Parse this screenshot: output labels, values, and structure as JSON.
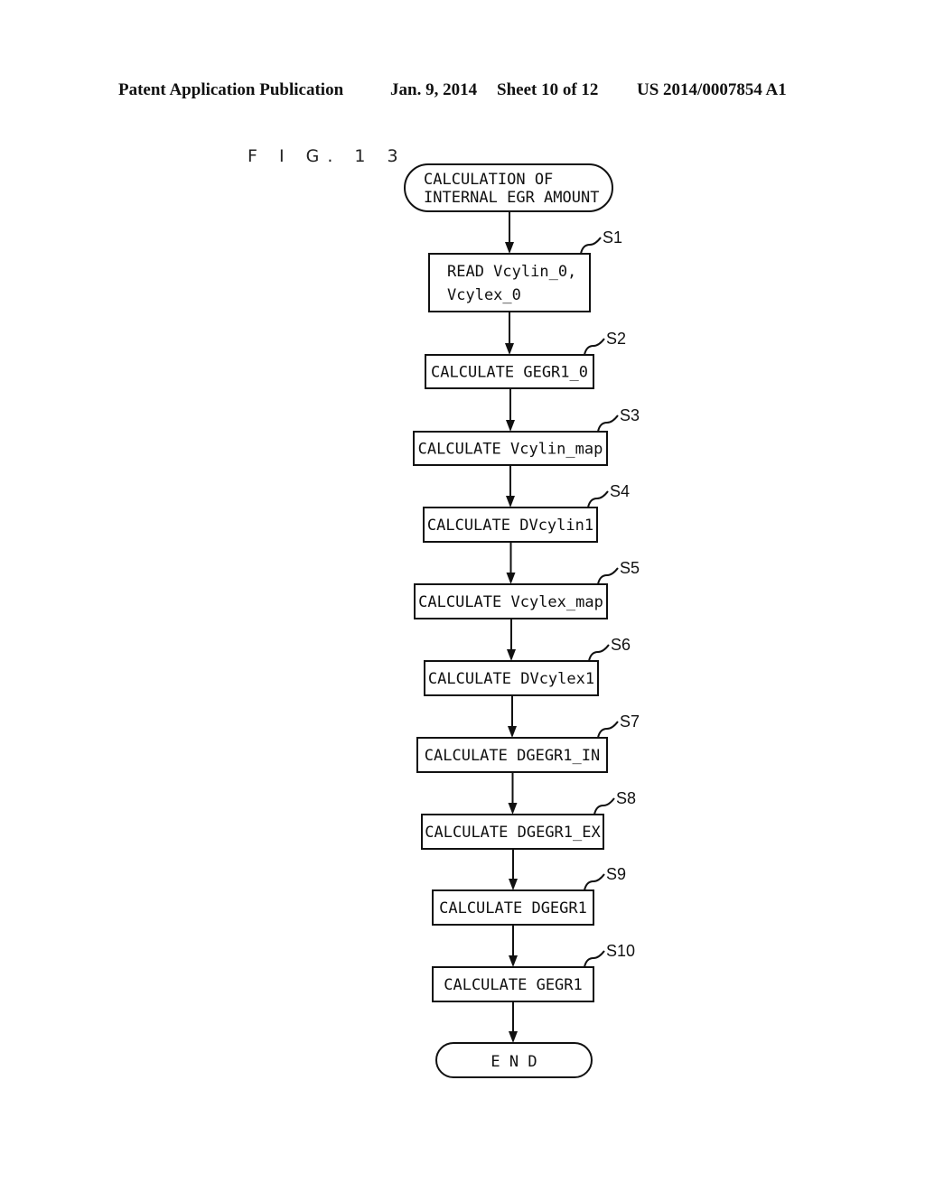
{
  "header": {
    "publication": "Patent Application Publication",
    "date": "Jan. 9, 2014",
    "sheet": "Sheet 10 of 12",
    "number": "US 2014/0007854 A1"
  },
  "figure": {
    "label": "F I G. 1 3",
    "start": {
      "lines": [
        "CALCULATION OF",
        "INTERNAL EGR AMOUNT"
      ]
    },
    "steps": [
      {
        "id": "S1",
        "lines": [
          "READ Vcylin_0,",
          "Vcylex_0"
        ]
      },
      {
        "id": "S2",
        "lines": [
          "CALCULATE GEGR1_0"
        ]
      },
      {
        "id": "S3",
        "lines": [
          "CALCULATE Vcylin_map"
        ]
      },
      {
        "id": "S4",
        "lines": [
          "CALCULATE DVcylin1"
        ]
      },
      {
        "id": "S5",
        "lines": [
          "CALCULATE Vcylex_map"
        ]
      },
      {
        "id": "S6",
        "lines": [
          "CALCULATE DVcylex1"
        ]
      },
      {
        "id": "S7",
        "lines": [
          "CALCULATE DGEGR1_IN"
        ]
      },
      {
        "id": "S8",
        "lines": [
          "CALCULATE DGEGR1_EX"
        ]
      },
      {
        "id": "S9",
        "lines": [
          "CALCULATE DGEGR1"
        ]
      },
      {
        "id": "S10",
        "lines": [
          "CALCULATE GEGR1"
        ]
      }
    ],
    "end": {
      "lines": [
        "E N D"
      ]
    }
  }
}
